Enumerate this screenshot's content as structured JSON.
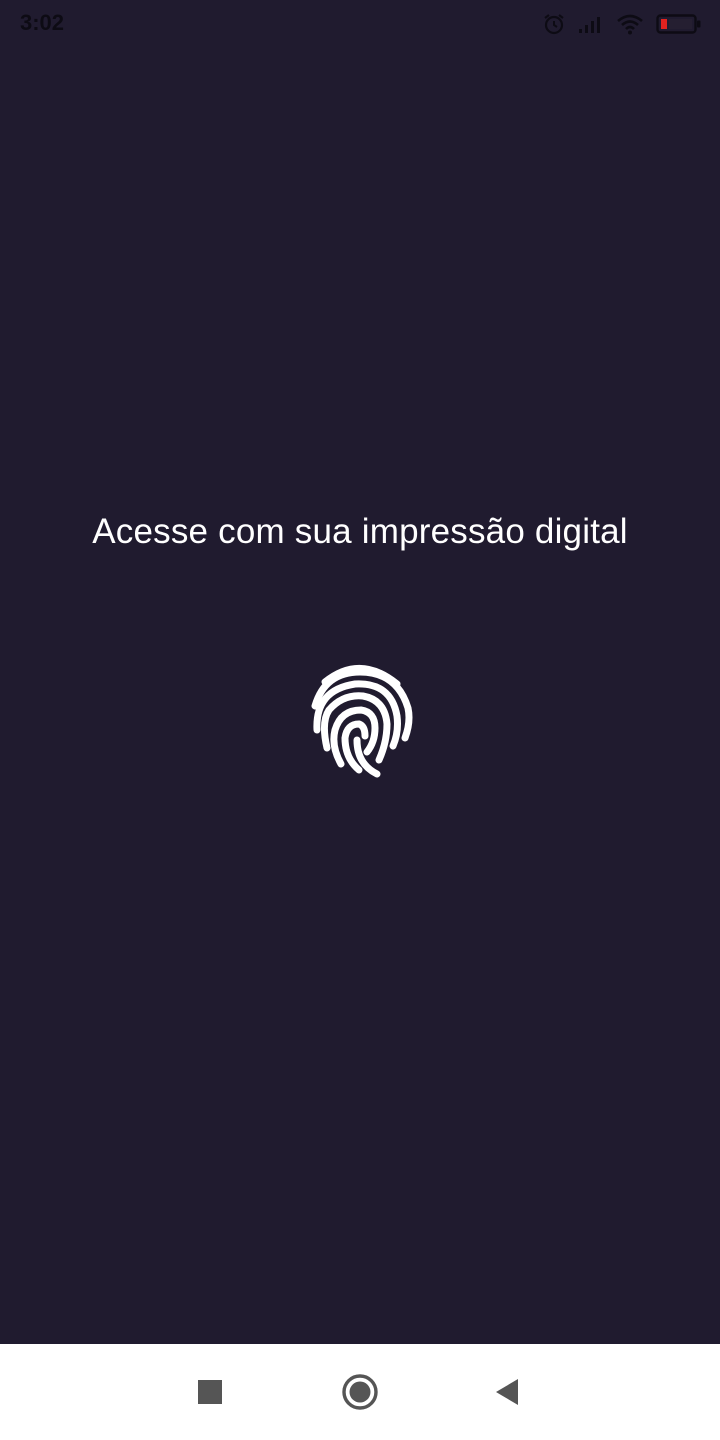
{
  "status_bar": {
    "time": "3:02",
    "icons": [
      "alarm-icon",
      "signal-icon",
      "wifi-icon",
      "battery-icon"
    ],
    "battery_color": "#e0221f"
  },
  "main": {
    "prompt": "Acesse com sua impressão digital",
    "fingerprint_icon": "fingerprint-icon"
  },
  "nav_bar": {
    "buttons": [
      "recents-button",
      "home-button",
      "back-button"
    ]
  },
  "colors": {
    "background": "#201b2f",
    "text": "#ffffff",
    "nav_background": "#ffffff",
    "nav_icon": "#555555"
  }
}
